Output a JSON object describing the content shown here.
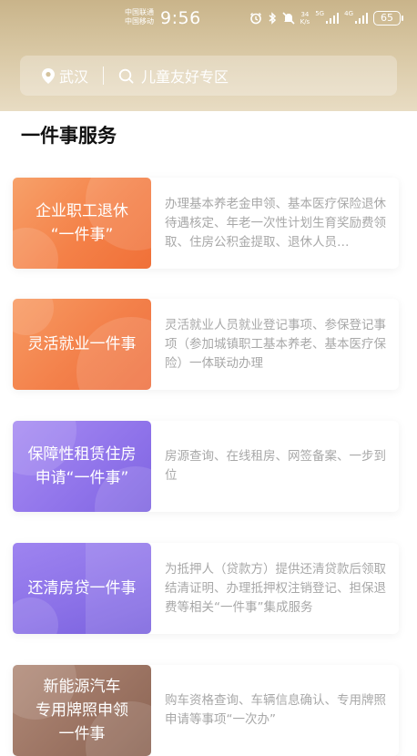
{
  "status_bar": {
    "carrier_1": "中国联通",
    "carrier_2": "中国移动",
    "time": "9:56",
    "net_speed_value": "34",
    "net_speed_unit": "K/s",
    "net_type_1": "5G",
    "net_type_2": "4G",
    "battery": "65"
  },
  "search_bar": {
    "location": "武汉",
    "placeholder": "儿童友好专区"
  },
  "section": {
    "title": "一件事服务"
  },
  "services": [
    {
      "title": "企业职工退休“一件事”",
      "title_line1": "企业职工退休",
      "title_line2": "“一件事”",
      "description": "办理基本养老金申领、基本医疗保险退休待遇核定、年老一次性计划生育奖励费领取、住房公积金提取、退休人员…"
    },
    {
      "title": "灵活就业一件事",
      "title_line1": "灵活就业一件事",
      "title_line2": "",
      "description": "灵活就业人员就业登记事项、参保登记事项（参加城镇职工基本养老、基本医疗保险）一体联动办理"
    },
    {
      "title": "保障性租赁住房申请“一件事”",
      "title_line1": "保障性租赁住房",
      "title_line2": "申请“一件事”",
      "description": "房源查询、在线租房、网签备案、一步到位"
    },
    {
      "title": "还清房贷一件事",
      "title_line1": "还清房贷一件事",
      "title_line2": "",
      "description": "为抵押人（贷款方）提供还清贷款后领取结清证明、办理抵押权注销登记、担保退费等相关“一件事”集成服务"
    },
    {
      "title": "新能源汽车专用牌照申领一件事",
      "title_line1": "新能源汽车",
      "title_line2": "专用牌照申领",
      "title_line3": "一件事",
      "description": "购车资格查询、车辆信息确认、专用牌照申请等事项“一次办”"
    }
  ],
  "colors": {
    "header_gold": "#c9b48a",
    "orange_card": "#f48148",
    "purple_card": "#8f73ea",
    "brown_card": "#9c7463",
    "description_gray": "#a8a8a8"
  },
  "icons": {
    "location": "location-pin-icon",
    "search": "search-icon",
    "alarm": "alarm-icon",
    "bluetooth": "bluetooth-icon",
    "mute": "mute-icon"
  }
}
